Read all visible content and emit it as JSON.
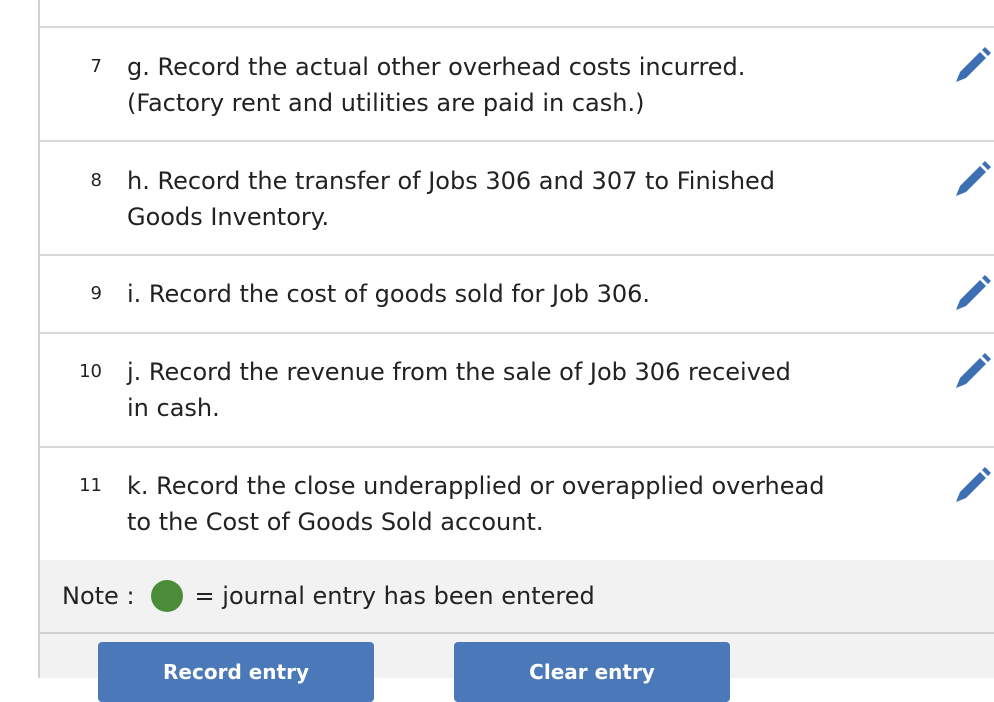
{
  "colors": {
    "pencil": "#3d6fb4",
    "entered_dot": "#4a8c3a",
    "button": "#4a78b8"
  },
  "rows": [
    {
      "number": "7",
      "lines": [
        "g. Record the actual other overhead costs incurred.",
        "(Factory rent and utilities are paid in cash.)"
      ],
      "edit_icon": "pencil-icon"
    },
    {
      "number": "8",
      "lines": [
        "h. Record the transfer of Jobs 306 and 307 to Finished",
        "Goods Inventory."
      ],
      "edit_icon": "pencil-icon"
    },
    {
      "number": "9",
      "lines": [
        "i. Record the cost of goods sold for Job 306."
      ],
      "edit_icon": "pencil-icon"
    },
    {
      "number": "10",
      "lines": [
        "j. Record the revenue from the sale of Job 306 received",
        "in cash."
      ],
      "edit_icon": "pencil-icon"
    },
    {
      "number": "11",
      "lines": [
        "k. Record the close underapplied or overapplied overhead",
        "to the Cost of Goods Sold account."
      ],
      "edit_icon": "pencil-icon"
    }
  ],
  "note": {
    "label": "Note :",
    "legend_text": "= journal entry has been entered"
  },
  "buttons": {
    "record": "Record entry",
    "clear": "Clear entry"
  }
}
